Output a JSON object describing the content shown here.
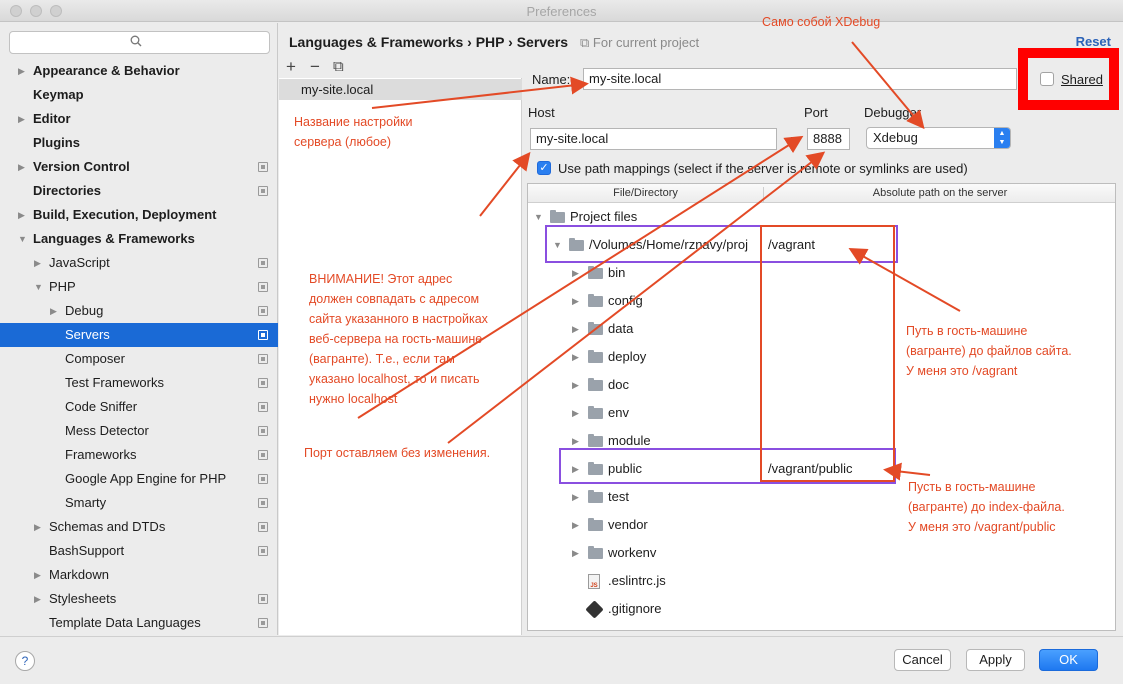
{
  "window": {
    "title": "Preferences"
  },
  "search": {
    "placeholder": ""
  },
  "tree": [
    {
      "label": "Appearance & Behavior",
      "arrow": "▶",
      "bold": true,
      "copy": false
    },
    {
      "label": "Keymap",
      "arrow": "",
      "bold": true,
      "copy": false
    },
    {
      "label": "Editor",
      "arrow": "▶",
      "bold": true,
      "copy": false
    },
    {
      "label": "Plugins",
      "arrow": "",
      "bold": true,
      "copy": false
    },
    {
      "label": "Version Control",
      "arrow": "▶",
      "bold": true,
      "copy": true
    },
    {
      "label": "Directories",
      "arrow": "",
      "bold": true,
      "copy": true
    },
    {
      "label": "Build, Execution, Deployment",
      "arrow": "▶",
      "bold": true,
      "copy": false
    },
    {
      "label": "Languages & Frameworks",
      "arrow": "▼",
      "bold": true,
      "copy": false
    },
    {
      "label": "JavaScript",
      "arrow": "▶",
      "bold": false,
      "copy": true
    },
    {
      "label": "PHP",
      "arrow": "▼",
      "bold": false,
      "copy": true
    },
    {
      "label": "Debug",
      "arrow": "▶",
      "bold": false,
      "copy": true
    },
    {
      "label": "Servers",
      "arrow": "",
      "bold": false,
      "copy": true
    },
    {
      "label": "Composer",
      "arrow": "",
      "bold": false,
      "copy": true
    },
    {
      "label": "Test Frameworks",
      "arrow": "",
      "bold": false,
      "copy": true
    },
    {
      "label": "Code Sniffer",
      "arrow": "",
      "bold": false,
      "copy": true
    },
    {
      "label": "Mess Detector",
      "arrow": "",
      "bold": false,
      "copy": true
    },
    {
      "label": "Frameworks",
      "arrow": "",
      "bold": false,
      "copy": true
    },
    {
      "label": "Google App Engine for PHP",
      "arrow": "",
      "bold": false,
      "copy": true
    },
    {
      "label": "Smarty",
      "arrow": "",
      "bold": false,
      "copy": true
    },
    {
      "label": "Schemas and DTDs",
      "arrow": "▶",
      "bold": false,
      "copy": true
    },
    {
      "label": "BashSupport",
      "arrow": "",
      "bold": false,
      "copy": true
    },
    {
      "label": "Markdown",
      "arrow": "▶",
      "bold": false,
      "copy": false
    },
    {
      "label": "Stylesheets",
      "arrow": "▶",
      "bold": false,
      "copy": true
    },
    {
      "label": "Template Data Languages",
      "arrow": "",
      "bold": false,
      "copy": true
    }
  ],
  "header": {
    "breadcrumb": "Languages & Frameworks › PHP › Servers",
    "scope": "For current project",
    "reset": "Reset"
  },
  "servers": {
    "add": "+",
    "remove": "−",
    "copy": "⧉",
    "items": [
      "my-site.local"
    ]
  },
  "form": {
    "name_label": "Name:",
    "name_value": "my-site.local",
    "shared_label": "Shared",
    "host_label": "Host",
    "host_value": "my-site.local",
    "colon": ":",
    "port_label": "Port",
    "port_value": "8888",
    "debugger_label": "Debugger",
    "debugger_value": "Xdebug",
    "path_mappings_label": "Use path mappings (select if the server is remote or symlinks are used)"
  },
  "mapping": {
    "col_file": "File/Directory",
    "col_server": "Absolute path on the server",
    "rows": [
      {
        "name": "Project files",
        "path": "",
        "arrow": "▼",
        "indent": 0,
        "icon": "folder"
      },
      {
        "name": "/Volumes/Home/rznavy/proj",
        "path": "/vagrant",
        "arrow": "▼",
        "indent": 1,
        "icon": "folder"
      },
      {
        "name": "bin",
        "path": "",
        "arrow": "▶",
        "indent": 2,
        "icon": "folder"
      },
      {
        "name": "config",
        "path": "",
        "arrow": "▶",
        "indent": 2,
        "icon": "folder"
      },
      {
        "name": "data",
        "path": "",
        "arrow": "▶",
        "indent": 2,
        "icon": "folder"
      },
      {
        "name": "deploy",
        "path": "",
        "arrow": "▶",
        "indent": 2,
        "icon": "folder"
      },
      {
        "name": "doc",
        "path": "",
        "arrow": "▶",
        "indent": 2,
        "icon": "folder"
      },
      {
        "name": "env",
        "path": "",
        "arrow": "▶",
        "indent": 2,
        "icon": "folder"
      },
      {
        "name": "module",
        "path": "",
        "arrow": "▶",
        "indent": 2,
        "icon": "folder"
      },
      {
        "name": "public",
        "path": "/vagrant/public",
        "arrow": "▶",
        "indent": 2,
        "icon": "folder"
      },
      {
        "name": "test",
        "path": "",
        "arrow": "▶",
        "indent": 2,
        "icon": "folder"
      },
      {
        "name": "vendor",
        "path": "",
        "arrow": "▶",
        "indent": 2,
        "icon": "folder"
      },
      {
        "name": "workenv",
        "path": "",
        "arrow": "▶",
        "indent": 2,
        "icon": "folder"
      },
      {
        "name": ".eslintrc.js",
        "path": "",
        "arrow": "",
        "indent": 2,
        "icon": "js"
      },
      {
        "name": ".gitignore",
        "path": "",
        "arrow": "",
        "indent": 2,
        "icon": "git"
      }
    ]
  },
  "buttons": {
    "help": "?",
    "cancel": "Cancel",
    "apply": "Apply",
    "ok": "OK"
  },
  "notes": {
    "xdebug": "Само собой XDebug",
    "server_name": "Название настройки\nсервера (любое)",
    "warning": "ВНИМАНИЕ! Этот адрес\nдолжен совпадать с адресом\nсайта указанного в настройках\nвеб-сервера на гость-машине\n(вагранте). Т.е., если там\nуказано localhost, то и писать\nнужно localhost",
    "port": "Порт оставляем без изменения.",
    "guest_path": "Путь в гость-машине\n(вагранте) до файлов сайта.\nУ меня это /vagrant",
    "index_path": "Пусть в гость-машине\n(вагранте) до index-файла.\nУ меня это /vagrant/public"
  },
  "colors": {
    "accent": "#1a6ad6",
    "annotation": "#e34a26",
    "highlight": "#8a4fe0"
  }
}
